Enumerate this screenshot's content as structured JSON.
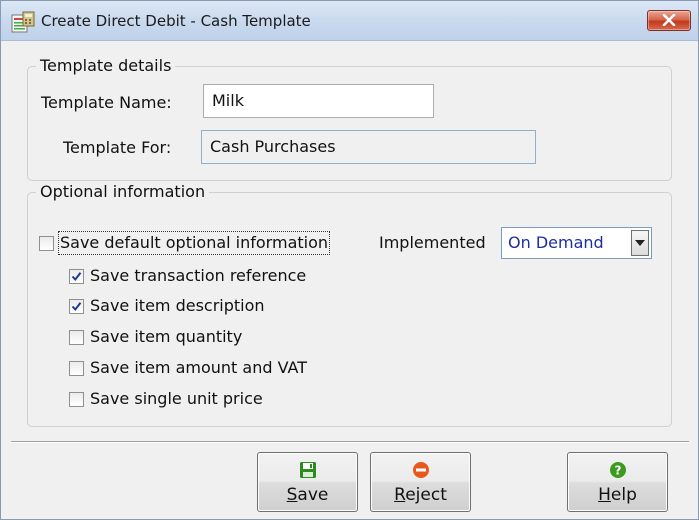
{
  "window": {
    "title": "Create Direct Debit - Cash Template"
  },
  "template_details": {
    "legend": "Template details",
    "name_label": "Template Name:",
    "name_value": "Milk",
    "for_label": "Template For:",
    "for_value": "Cash Purchases"
  },
  "optional_information": {
    "legend": "Optional information",
    "save_default": {
      "label": "Save default optional information",
      "checked": false
    },
    "implemented_label": "Implemented",
    "implemented_value": "On Demand",
    "options": [
      {
        "label": "Save transaction reference",
        "checked": true
      },
      {
        "label": "Save item description",
        "checked": true
      },
      {
        "label": "Save item quantity",
        "checked": false
      },
      {
        "label": "Save item amount and VAT",
        "checked": false
      },
      {
        "label": "Save single unit price",
        "checked": false
      }
    ]
  },
  "buttons": {
    "save": {
      "mnemonic": "S",
      "rest": "ave"
    },
    "reject": {
      "mnemonic": "R",
      "rest": "eject"
    },
    "help": {
      "mnemonic": "H",
      "rest": "elp"
    }
  },
  "colors": {
    "save_icon": "#2f8a22",
    "reject_icon": "#e8581c",
    "help_icon": "#3c9a1f",
    "dropdown_text": "#1b2fa0"
  },
  "icons": {
    "app": "ledger-calculator-icon",
    "close": "close-icon",
    "save": "floppy-disk-icon",
    "reject": "no-entry-icon",
    "help": "question-mark-icon",
    "dropdown": "chevron-down-icon",
    "check": "checkmark-icon"
  }
}
